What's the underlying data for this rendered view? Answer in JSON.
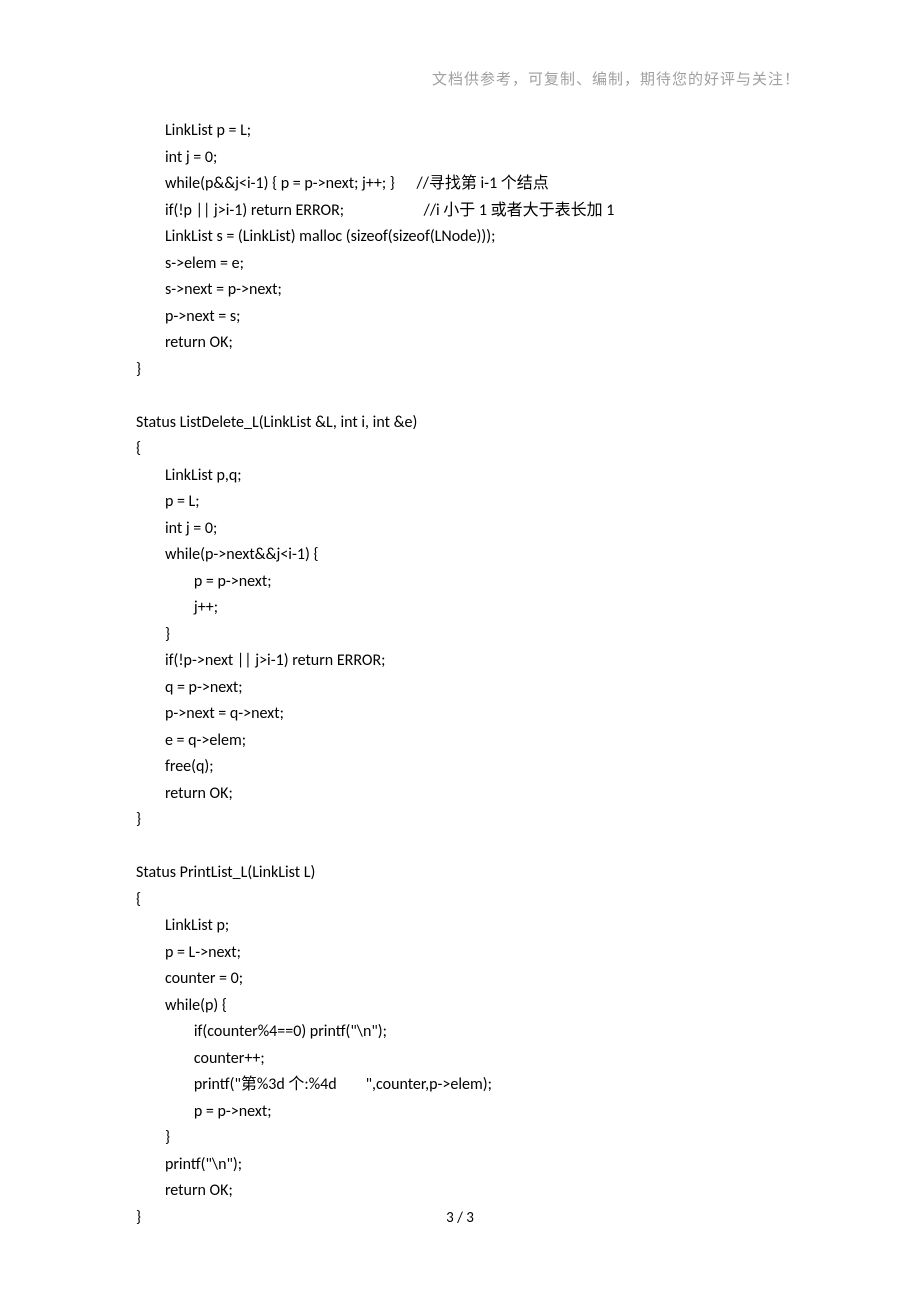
{
  "header": {
    "notice": "文档供参考，可复制、编制，期待您的好评与关注！"
  },
  "code": {
    "content": "        LinkList p = L;\n        int j = 0;\n        while(p&&j<i-1) { p = p->next; j++; }      //寻找第 i-1 个结点\n        if(!p || j>i-1) return ERROR;                      //i 小于 1 或者大于表长加 1\n        LinkList s = (LinkList) malloc (sizeof(sizeof(LNode)));\n        s->elem = e;\n        s->next = p->next;\n        p->next = s;\n        return OK;\n}\n\nStatus ListDelete_L(LinkList &L, int i, int &e)\n{\n        LinkList p,q;\n        p = L;\n        int j = 0;\n        while(p->next&&j<i-1) {\n                p = p->next;\n                j++;\n        }\n        if(!p->next || j>i-1) return ERROR;\n        q = p->next;\n        p->next = q->next;\n        e = q->elem;\n        free(q);\n        return OK;\n}\n\nStatus PrintList_L(LinkList L)\n{\n        LinkList p;\n        p = L->next;\n        counter = 0;\n        while(p) {\n                if(counter%4==0) printf(\"\\n\");\n                counter++;\n                printf(\"第%3d 个:%4d        \",counter,p->elem);\n                p = p->next;\n        }\n        printf(\"\\n\");\n        return OK;\n}"
  },
  "footer": {
    "page_label": "3 / 3"
  }
}
